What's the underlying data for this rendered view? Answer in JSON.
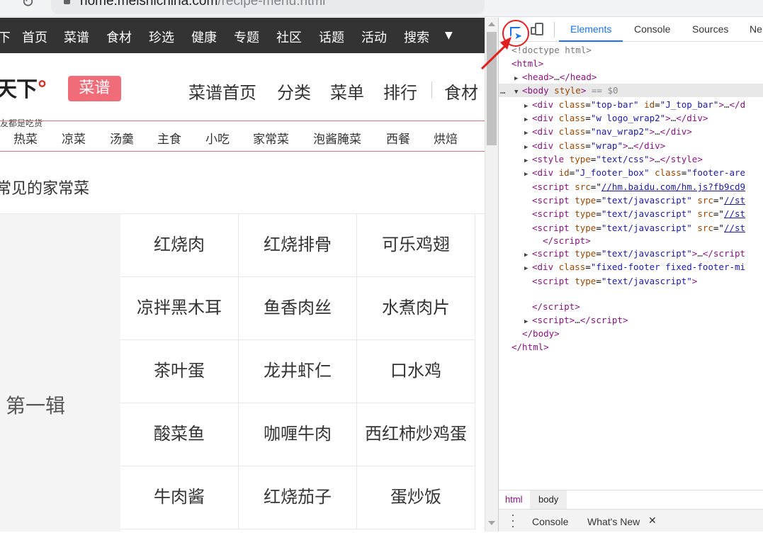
{
  "browser": {
    "url_domain": "home.meishichina.com",
    "url_path": "/recipe-menu.html"
  },
  "page": {
    "top_nav": [
      "首页",
      "菜谱",
      "食材",
      "珍选",
      "健康",
      "专题",
      "社区",
      "话题",
      "活动",
      "搜索"
    ],
    "top_nav_edge": "下",
    "top_nav_more": "▼",
    "logo_text": "天下",
    "logo_subtitle": "友都是吃货",
    "badge": "菜谱",
    "main_nav": [
      "菜谱首页",
      "分类",
      "菜单",
      "排行",
      "食材"
    ],
    "category_nav": [
      "热菜",
      "凉菜",
      "汤羹",
      "主食",
      "小吃",
      "家常菜",
      "泡酱腌菜",
      "西餐",
      "烘焙"
    ],
    "section_title": "常见的家常菜",
    "series_label": "第一辑",
    "dishes": [
      [
        "红烧肉",
        "红烧排骨",
        "可乐鸡翅"
      ],
      [
        "凉拌黑木耳",
        "鱼香肉丝",
        "水煮肉片"
      ],
      [
        "茶叶蛋",
        "龙井虾仁",
        "口水鸡"
      ],
      [
        "酸菜鱼",
        "咖喱牛肉",
        "西红柿炒鸡蛋"
      ],
      [
        "牛肉酱",
        "红烧茄子",
        "蛋炒饭"
      ]
    ]
  },
  "devtools": {
    "tabs": [
      "Elements",
      "Console",
      "Sources",
      "Ne"
    ],
    "active_tab": "Elements",
    "dom_lines": {
      "doctype": "<!doctype html>",
      "html_open": "html",
      "head": "head",
      "body_attr": "style",
      "body_eq": "== $0",
      "div1_class": "\"top-bar\"",
      "div1_id": "\"J_top_bar\"",
      "div2_class": "\"w logo_wrap2\"",
      "div3_class": "\"nav_wrap2\"",
      "div4_class": "\"wrap\"",
      "style_type": "\"text/css\"",
      "footer_id": "\"J_footer_box\"",
      "footer_class": "\"footer-are",
      "script1_src": "//hm.baidu.com/hm.js?fb9cd9",
      "script_type": "\"text/javascript\"",
      "script_src_cut": "//st",
      "fixed_footer_class": "\"fixed-footer fixed-footer-mi"
    },
    "breadcrumbs": [
      "html",
      "body"
    ],
    "drawer_tabs": [
      "Console",
      "What's New"
    ]
  },
  "colors": {
    "top_nav_bg": "#333333",
    "badge_bg": "#f06c79",
    "devtools_accent": "#1a73e8",
    "annotation_red": "#e02020"
  }
}
